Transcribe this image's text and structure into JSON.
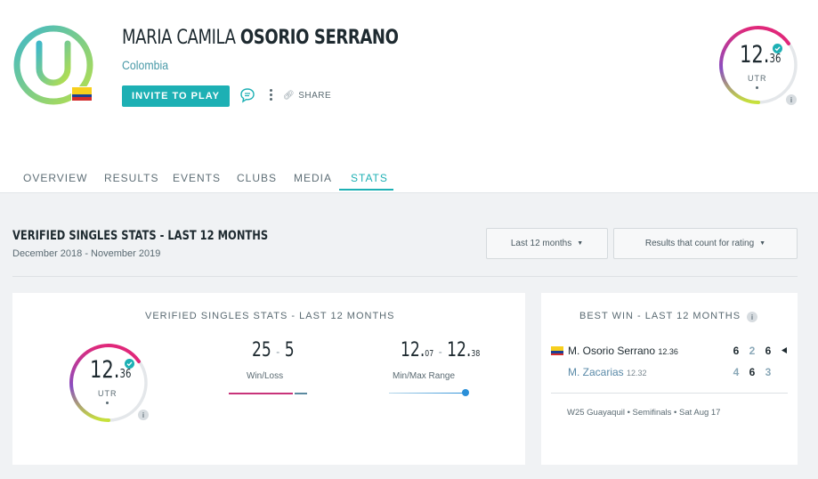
{
  "player": {
    "first_name": "MARIA CAMILA",
    "last_name": "OSORIO SERRANO",
    "country": "Colombia",
    "invite_label": "INVITE TO PLAY",
    "share_label": "SHARE",
    "utr_whole": "12.",
    "utr_decimal": "36",
    "utr_label": "UTR",
    "info_mark": "i"
  },
  "tabs": [
    {
      "label": "OVERVIEW"
    },
    {
      "label": "RESULTS"
    },
    {
      "label": "EVENTS"
    },
    {
      "label": "CLUBS"
    },
    {
      "label": "MEDIA"
    },
    {
      "label": "STATS"
    }
  ],
  "active_tab": "STATS",
  "stats": {
    "title": "VERIFIED SINGLES STATS - LAST 12 MONTHS",
    "period": "December 2018 - November 2019",
    "filter_period": "Last 12 months",
    "filter_results": "Results that count for rating",
    "card_title": "VERIFIED SINGLES STATS - LAST 12 MONTHS",
    "utr_whole": "12.",
    "utr_decimal": "36",
    "utr_label": "UTR",
    "wins": "25",
    "losses": "5",
    "win_fraction": 0.833,
    "winloss_label": "Win/Loss",
    "min_whole": "12.",
    "min_decimal": "07",
    "max_whole": "12.",
    "max_decimal": "38",
    "range_label": "Min/Max Range",
    "range_dash": "-",
    "wl_dash": "-"
  },
  "best_win": {
    "title": "BEST WIN - LAST 12 MONTHS",
    "winner_name": "M. Osorio Serrano",
    "winner_utr": "12.36",
    "winner_scores": [
      "6",
      "2",
      "6"
    ],
    "loser_name": "M. Zacarias",
    "loser_utr": "12.32",
    "loser_scores": [
      "4",
      "6",
      "3"
    ],
    "match_info": "W25 Guayaquil • Semifinals • Sat Aug 17"
  },
  "colors": {
    "accent": "#1db0b4",
    "ring_magenta": "#e0287a",
    "ring_green": "#c7e23a",
    "win_bar": "#c8337a",
    "loss_bar": "#5b8aa0",
    "range_dot": "#2a8fd8"
  },
  "icons": [
    "app-logo-icon",
    "colombia-flag-icon",
    "chat-icon",
    "more-icon",
    "link-icon",
    "verified-icon",
    "info-icon",
    "caret-down-icon",
    "serve-indicator-icon"
  ]
}
